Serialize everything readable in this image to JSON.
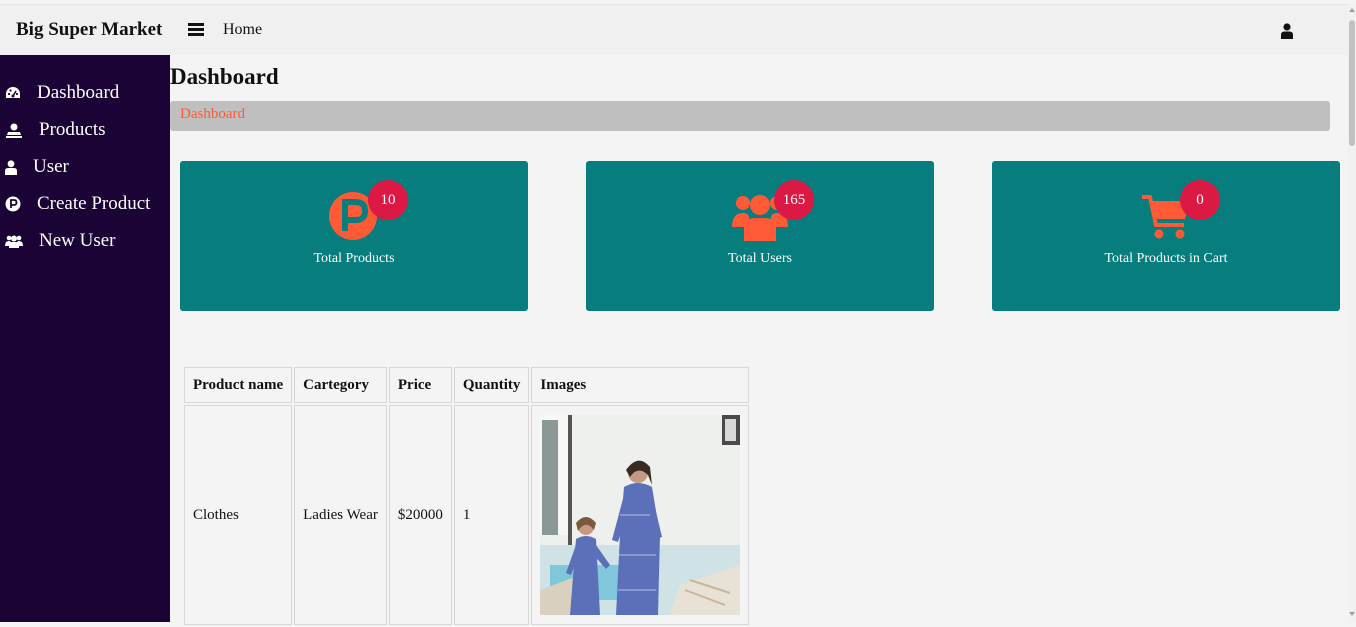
{
  "header": {
    "brand": "Big Super Market",
    "menu_icon": "hamburger-icon",
    "home_link": "Home",
    "user_icon": "user-icon"
  },
  "sidebar": {
    "items": [
      {
        "label": "Dashboard",
        "icon": "tachometer-icon"
      },
      {
        "label": "Products",
        "icon": "product-box-icon"
      },
      {
        "label": "User",
        "icon": "user-icon"
      },
      {
        "label": "Create Product",
        "icon": "product-p-icon"
      },
      {
        "label": "New User",
        "icon": "users-icon"
      }
    ]
  },
  "main": {
    "title": "Dashboard",
    "breadcrumb": "Dashboard",
    "cards": [
      {
        "label": "Total Products",
        "count": "10",
        "icon": "product-p-icon"
      },
      {
        "label": "Total Users",
        "count": "165",
        "icon": "users-icon"
      },
      {
        "label": "Total Products in Cart",
        "count": "0",
        "icon": "cart-icon"
      }
    ]
  },
  "table": {
    "headers": [
      "Product name",
      "Cartegory",
      "Price",
      "Quantity",
      "Images"
    ],
    "rows": [
      {
        "name": "Clothes",
        "category": "Ladies Wear",
        "price": "$20000",
        "quantity": "1"
      }
    ]
  },
  "colors": {
    "sidebar": "#1c0336",
    "card": "#087d7d",
    "accent": "#ff5a36",
    "badge": "#dc1845",
    "breadcrumb_bg": "#bfbfbf"
  }
}
